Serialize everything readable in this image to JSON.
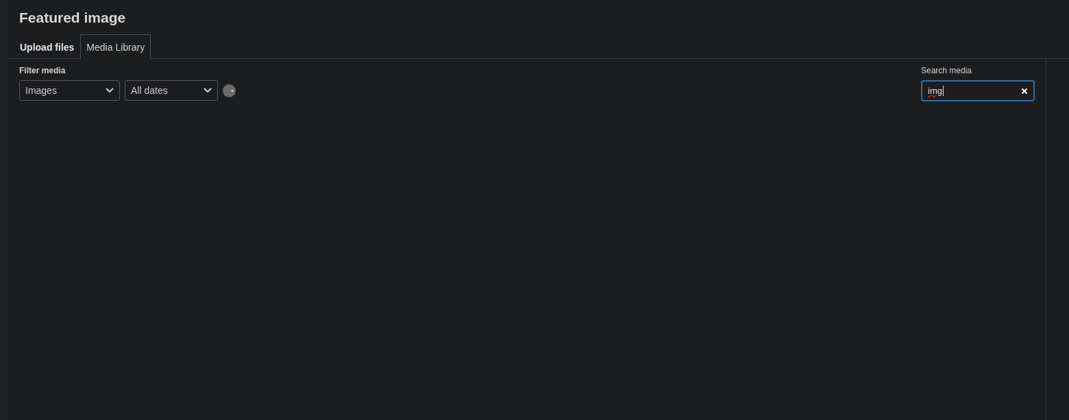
{
  "modal": {
    "title": "Featured image"
  },
  "tabs": [
    {
      "label": "Upload files",
      "selected": false
    },
    {
      "label": "Media Library",
      "selected": true
    }
  ],
  "filter": {
    "label": "Filter media",
    "selects": [
      "Images",
      "All dates"
    ]
  },
  "search": {
    "label": "Search media",
    "value": "img"
  }
}
